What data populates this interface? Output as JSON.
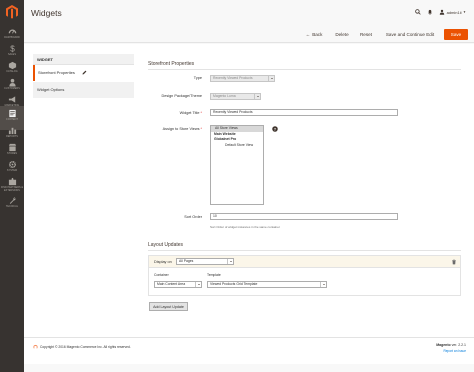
{
  "sidebar": {
    "items": [
      {
        "label": "Dashboard",
        "icon": "dashboard-icon"
      },
      {
        "label": "Sales",
        "icon": "dollar-icon"
      },
      {
        "label": "Catalog",
        "icon": "cube-icon"
      },
      {
        "label": "Customers",
        "icon": "person-icon"
      },
      {
        "label": "Marketing",
        "icon": "megaphone-icon"
      },
      {
        "label": "Content",
        "icon": "content-icon"
      },
      {
        "label": "Reports",
        "icon": "bar-chart-icon"
      },
      {
        "label": "Stores",
        "icon": "store-icon"
      },
      {
        "label": "System",
        "icon": "gear-icon"
      },
      {
        "label": "Find Partners & Extensions",
        "icon": "puzzle-icon"
      },
      {
        "label": "Tecnical",
        "icon": "wrench-icon"
      }
    ],
    "active_index": 5
  },
  "header": {
    "title": "Widgets",
    "user": "admin1ii",
    "icons": [
      "search-icon",
      "bell-icon",
      "user-icon"
    ]
  },
  "actions": {
    "back": "Back",
    "delete": "Delete",
    "reset": "Reset",
    "save_continue": "Save and Continue Edit",
    "save": "Save"
  },
  "tabs": {
    "title": "WIDGET",
    "items": [
      "Storefront Properties",
      "Widget Options"
    ]
  },
  "form": {
    "section_title": "Storefront Properties",
    "type_label": "Type",
    "type_value": "Recently Viewed Products",
    "design_label": "Design Package/Theme",
    "design_value": "Magento Luma",
    "widget_title_label": "Widget Title",
    "widget_title_value": "Recently Viewed Products",
    "store_views_label": "Assign to Store Views",
    "store_views_options": [
      {
        "label": "All Store Views",
        "kind": "sel"
      },
      {
        "label": "Main Website",
        "kind": "group"
      },
      {
        "label": "Globalnet Pro",
        "kind": "group"
      },
      {
        "label": "Default Store View",
        "kind": "store"
      }
    ],
    "sort_order_label": "Sort Order",
    "sort_order_value": "10",
    "sort_order_note": "Sort Order of widget instances in the same container"
  },
  "layout_updates": {
    "title": "Layout Updates",
    "display_on_label": "Display on",
    "display_on_value": "All Pages",
    "container_label": "Container",
    "container_value": "Main Content Area",
    "template_label": "Template",
    "template_value": "Viewed Products Grid Template",
    "add_button": "Add Layout Update"
  },
  "footer": {
    "copyright": "Copyright © 2016 Magento Commerce Inc. All rights reserved.",
    "brand": "Magento",
    "version": " ver. 2.2.1",
    "report": "Report an Issue"
  },
  "colors": {
    "sidebar_bg": "#373330",
    "accent": "#eb5202",
    "required": "#e22626"
  }
}
